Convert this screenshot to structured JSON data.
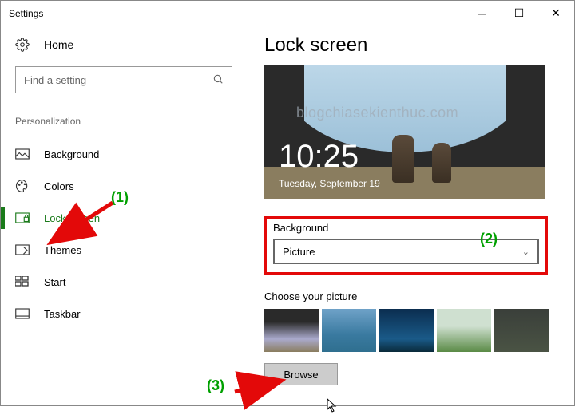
{
  "window": {
    "title": "Settings"
  },
  "sidebar": {
    "home": "Home",
    "search_placeholder": "Find a setting",
    "section": "Personalization",
    "items": [
      {
        "label": "Background"
      },
      {
        "label": "Colors"
      },
      {
        "label": "Lock screen",
        "active": true
      },
      {
        "label": "Themes"
      },
      {
        "label": "Start"
      },
      {
        "label": "Taskbar"
      }
    ]
  },
  "content": {
    "heading": "Lock screen",
    "preview_time": "10:25",
    "preview_date": "Tuesday, September 19",
    "watermark": "blogchiasekienthuc.com",
    "background_label": "Background",
    "background_value": "Picture",
    "choose_label": "Choose your picture",
    "browse_label": "Browse"
  },
  "annotations": {
    "a1": "(1)",
    "a2": "(2)",
    "a3": "(3)"
  }
}
